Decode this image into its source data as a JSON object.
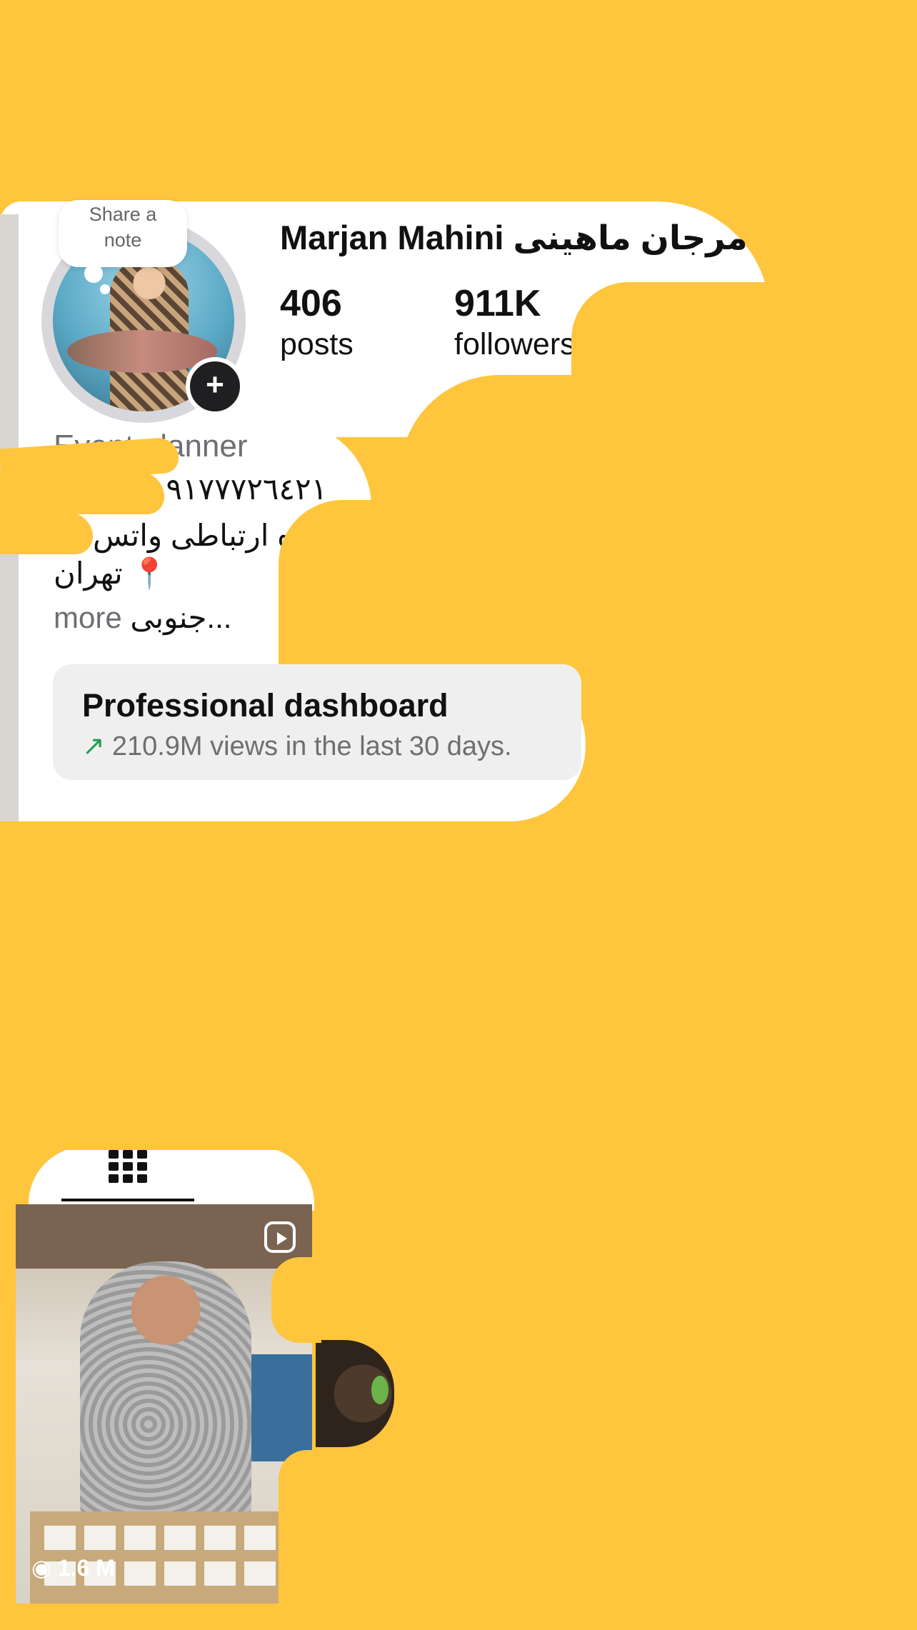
{
  "profile": {
    "note_bubble": [
      "Share a",
      "note"
    ],
    "name": "Marjan Mahini مرجان ماهینی",
    "stats": [
      {
        "value": "406",
        "label": "posts"
      },
      {
        "value": "911K",
        "label": "followers"
      }
    ],
    "add_story_icon": "plus-icon"
  },
  "bio": {
    "category": "Event planner",
    "phone": "۰۹۱۷۷۷۲٦٤۲۱",
    "line2": "راه ارتباطی واتس",
    "line3": "تهران 📍",
    "line4_text": "جنوبی...",
    "more_label": "more"
  },
  "dashboard": {
    "title": "Professional dashboard",
    "subtitle": "210.9M views in the last 30 days.",
    "trend_icon": "arrow-up-right-icon",
    "trend_color": "#1f9d55"
  },
  "tabs": {
    "active_icon": "grid-icon"
  },
  "grid": {
    "items": [
      {
        "type": "reel",
        "icon": "reels-icon",
        "views": "1.6 M",
        "views_icon": "eye-icon"
      },
      {
        "type": "post"
      }
    ]
  },
  "colors": {
    "cover": "#FFC53D",
    "text": "#111111",
    "muted": "#6e6e73"
  }
}
